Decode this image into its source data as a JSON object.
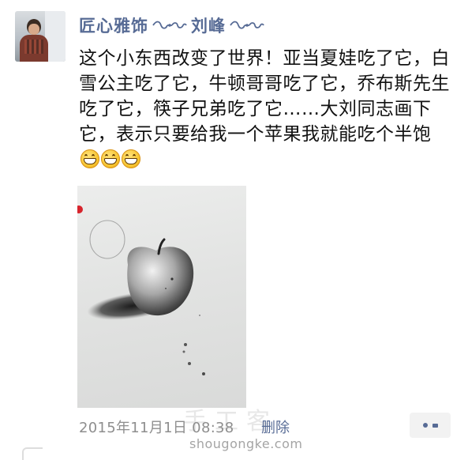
{
  "post": {
    "username": "匠心雅饰",
    "author": "刘峰",
    "text": "这个小东西改变了世界！亚当夏娃吃了它，白雪公主吃了它，牛顿哥哥吃了它，乔布斯先生吃了它，筷子兄弟吃了它……大刘同志画下它，表示只要给我一个苹果我就能吃个半饱",
    "emojis": [
      "grin-emoji",
      "grin-emoji",
      "grin-emoji"
    ],
    "timestamp": "2015年11月1日 08:38",
    "delete_label": "删除"
  },
  "watermark": {
    "logo": "手工客",
    "url": "shougongke.com"
  },
  "colors": {
    "name_link": "#576b95",
    "text": "#111111",
    "meta": "#8e8e8e",
    "more_bg": "#f2f2f2"
  },
  "icons": {
    "name_decoration": "flourish-icon",
    "more": "more-dots-icon"
  }
}
